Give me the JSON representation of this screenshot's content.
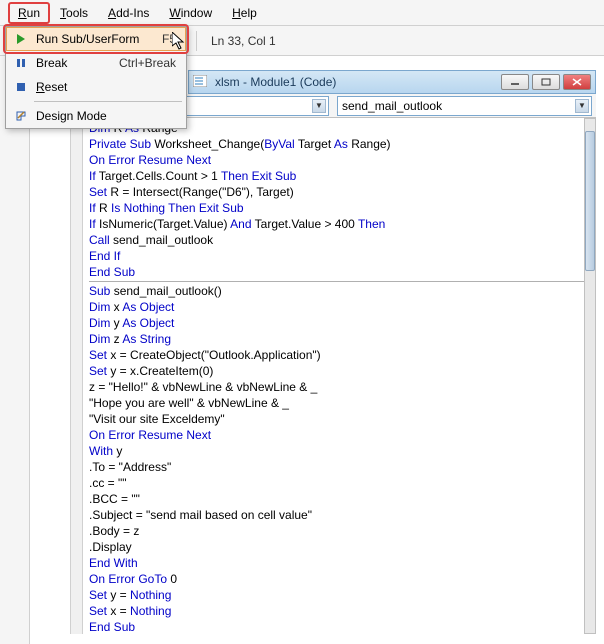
{
  "menubar": {
    "run": "Run",
    "tools": "Tools",
    "addins": "Add-Ins",
    "window": "Window",
    "help": "Help"
  },
  "status": {
    "pos": "Ln 33, Col 1"
  },
  "runmenu": {
    "runsub": "Run Sub/UserForm",
    "runsub_sc": "F5",
    "break": "Break",
    "break_sc": "Ctrl+Break",
    "reset": "Reset",
    "design": "Design Mode"
  },
  "doc": {
    "title": "xlsm - Module1 (Code)"
  },
  "combos": {
    "left": "",
    "right": "send_mail_outlook"
  },
  "code": [
    {
      "t": "line",
      "s": [
        [
          "kw",
          "Dim"
        ],
        [
          "tx",
          " R "
        ],
        [
          "kw",
          "As"
        ],
        [
          "tx",
          " Range"
        ]
      ]
    },
    {
      "t": "line",
      "s": [
        [
          "kw",
          "Private Sub"
        ],
        [
          "tx",
          " Worksheet_Change("
        ],
        [
          "kw",
          "ByVal"
        ],
        [
          "tx",
          " Target "
        ],
        [
          "kw",
          "As"
        ],
        [
          "tx",
          " Range)"
        ]
      ]
    },
    {
      "t": "line",
      "s": [
        [
          "kw",
          "On Error Resume Next"
        ]
      ]
    },
    {
      "t": "line",
      "s": [
        [
          "kw",
          "If"
        ],
        [
          "tx",
          " Target.Cells.Count > 1 "
        ],
        [
          "kw",
          "Then Exit Sub"
        ]
      ]
    },
    {
      "t": "line",
      "s": [
        [
          "kw",
          "Set"
        ],
        [
          "tx",
          " R = Intersect(Range(\"D6\"), Target)"
        ]
      ]
    },
    {
      "t": "line",
      "s": [
        [
          "kw",
          "If"
        ],
        [
          "tx",
          " R "
        ],
        [
          "kw",
          "Is Nothing Then Exit Sub"
        ]
      ]
    },
    {
      "t": "line",
      "s": [
        [
          "kw",
          "If"
        ],
        [
          "tx",
          " IsNumeric(Target.Value) "
        ],
        [
          "kw",
          "And"
        ],
        [
          "tx",
          " Target.Value > 400 "
        ],
        [
          "kw",
          "Then"
        ]
      ]
    },
    {
      "t": "line",
      "s": [
        [
          "kw",
          "Call"
        ],
        [
          "tx",
          " send_mail_outlook"
        ]
      ]
    },
    {
      "t": "line",
      "s": [
        [
          "kw",
          "End If"
        ]
      ]
    },
    {
      "t": "line",
      "s": [
        [
          "kw",
          "End Sub"
        ]
      ]
    },
    {
      "t": "hr"
    },
    {
      "t": "line",
      "s": [
        [
          "kw",
          "Sub"
        ],
        [
          "tx",
          " send_mail_outlook()"
        ]
      ]
    },
    {
      "t": "line",
      "s": [
        [
          "kw",
          "Dim"
        ],
        [
          "tx",
          " x "
        ],
        [
          "kw",
          "As Object"
        ]
      ]
    },
    {
      "t": "line",
      "s": [
        [
          "kw",
          "Dim"
        ],
        [
          "tx",
          " y "
        ],
        [
          "kw",
          "As Object"
        ]
      ]
    },
    {
      "t": "line",
      "s": [
        [
          "kw",
          "Dim"
        ],
        [
          "tx",
          " z "
        ],
        [
          "kw",
          "As String"
        ]
      ]
    },
    {
      "t": "line",
      "s": [
        [
          "kw",
          "Set"
        ],
        [
          "tx",
          " x = CreateObject(\"Outlook.Application\")"
        ]
      ]
    },
    {
      "t": "line",
      "s": [
        [
          "kw",
          "Set"
        ],
        [
          "tx",
          " y = x.CreateItem(0)"
        ]
      ]
    },
    {
      "t": "line",
      "s": [
        [
          "tx",
          "z = \"Hello!\" & vbNewLine & vbNewLine & _"
        ]
      ]
    },
    {
      "t": "line",
      "s": [
        [
          "tx",
          "\"Hope you are well\" & vbNewLine & _"
        ]
      ]
    },
    {
      "t": "line",
      "s": [
        [
          "tx",
          "\"Visit our site Exceldemy\""
        ]
      ]
    },
    {
      "t": "line",
      "s": [
        [
          "kw",
          "On Error Resume Next"
        ]
      ]
    },
    {
      "t": "line",
      "s": [
        [
          "kw",
          "With"
        ],
        [
          "tx",
          " y"
        ]
      ]
    },
    {
      "t": "line",
      "s": [
        [
          "tx",
          ".To = \"Address\""
        ]
      ]
    },
    {
      "t": "line",
      "s": [
        [
          "tx",
          ".cc = \"\""
        ]
      ]
    },
    {
      "t": "line",
      "s": [
        [
          "tx",
          ".BCC = \"\""
        ]
      ]
    },
    {
      "t": "line",
      "s": [
        [
          "tx",
          ".Subject = \"send mail based on cell value\""
        ]
      ]
    },
    {
      "t": "line",
      "s": [
        [
          "tx",
          ".Body = z"
        ]
      ]
    },
    {
      "t": "line",
      "s": [
        [
          "tx",
          ".Display"
        ]
      ]
    },
    {
      "t": "line",
      "s": [
        [
          "kw",
          "End With"
        ]
      ]
    },
    {
      "t": "line",
      "s": [
        [
          "kw",
          "On Error GoTo"
        ],
        [
          "tx",
          " 0"
        ]
      ]
    },
    {
      "t": "line",
      "s": [
        [
          "kw",
          "Set"
        ],
        [
          "tx",
          " y = "
        ],
        [
          "kw",
          "Nothing"
        ]
      ]
    },
    {
      "t": "line",
      "s": [
        [
          "kw",
          "Set"
        ],
        [
          "tx",
          " x = "
        ],
        [
          "kw",
          "Nothing"
        ]
      ]
    },
    {
      "t": "line",
      "s": [
        [
          "kw",
          "End Sub"
        ]
      ]
    }
  ]
}
